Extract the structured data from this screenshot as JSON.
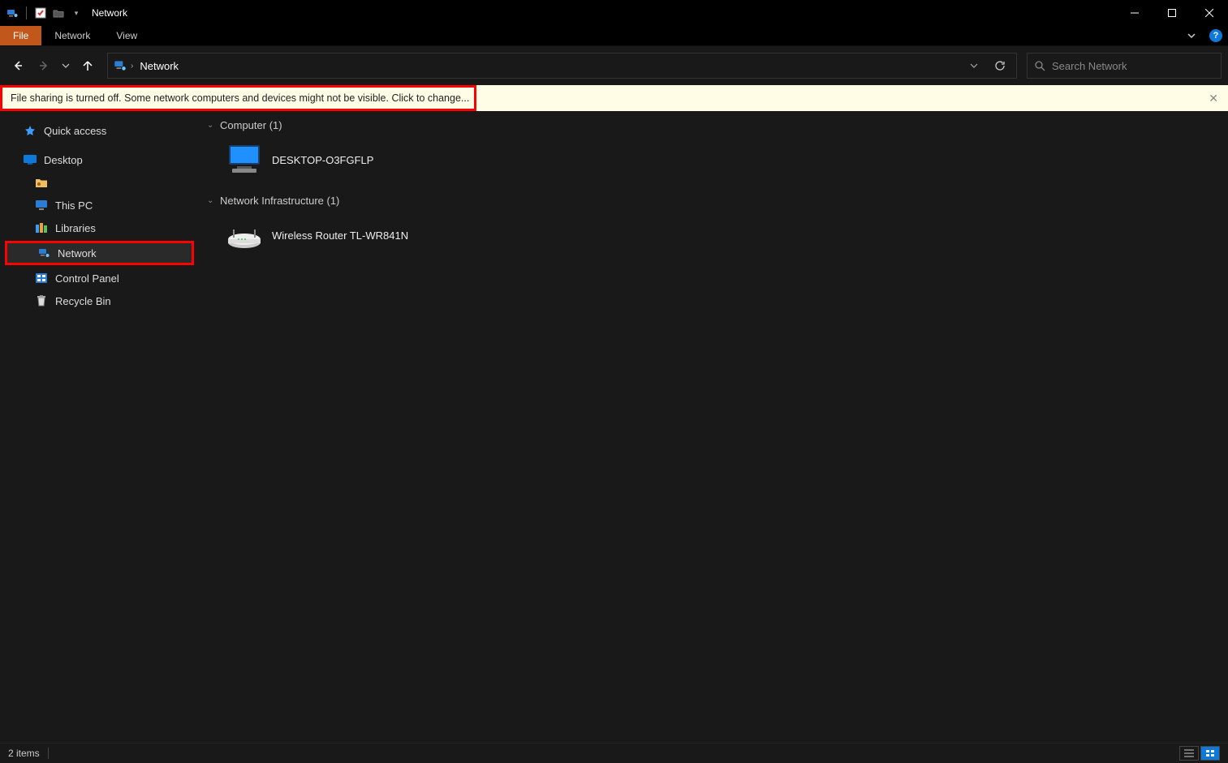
{
  "titlebar": {
    "title": "Network"
  },
  "ribbon": {
    "tabs": {
      "file": "File",
      "network": "Network",
      "view": "View"
    }
  },
  "nav": {
    "breadcrumb": "Network",
    "search_placeholder": "Search Network"
  },
  "infobar": {
    "message": "File sharing is turned off. Some network computers and devices might not be visible. Click to change..."
  },
  "sidebar": {
    "quick_access": "Quick access",
    "desktop": "Desktop",
    "blank_user": "",
    "this_pc": "This PC",
    "libraries": "Libraries",
    "network": "Network",
    "control_panel": "Control Panel",
    "recycle_bin": "Recycle Bin"
  },
  "content": {
    "group_computer": "Computer (1)",
    "computer_item": "DESKTOP-O3FGFLP",
    "group_infra": "Network Infrastructure (1)",
    "infra_item": "Wireless Router TL-WR841N"
  },
  "statusbar": {
    "count": "2 items"
  }
}
